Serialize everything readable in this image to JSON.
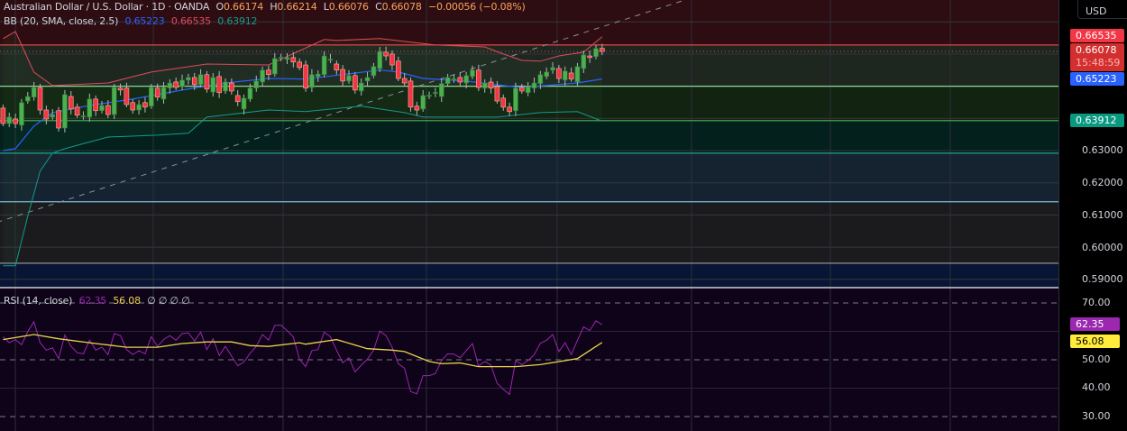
{
  "header": {
    "symbol": "Australian Dollar / U.S. Dollar · 1D · OANDA",
    "o_label": "O",
    "o_value": "0.66174",
    "h_label": "H",
    "h_value": "0.66214",
    "l_label": "L",
    "l_value": "0.66076",
    "c_label": "C",
    "c_value": "0.66078",
    "change": "−0.00056 (−0.08%)"
  },
  "bb_legend": {
    "label": "BB (20, SMA, close, 2.5)",
    "basis": "0.65223",
    "upper": "0.66535",
    "lower": "0.63912"
  },
  "rsi_legend": {
    "label": "RSI (14, close)",
    "rsi": "62.35",
    "ma": "56.08",
    "empty": "∅ ∅ ∅ ∅"
  },
  "currency_button": "USD",
  "price_axis": {
    "ticks": [
      "0.63000",
      "0.62000",
      "0.61000",
      "0.60000",
      "0.59000"
    ],
    "tags": {
      "bb_upper": "0.66535",
      "last_price": "0.66078",
      "countdown": "15:48:59",
      "bb_basis": "0.65223",
      "bb_lower": "0.63912"
    }
  },
  "rsi_axis": {
    "ticks": [
      "70.00",
      "50.00",
      "40.00",
      "30.00"
    ],
    "tags": {
      "rsi": "62.35",
      "ma": "56.08"
    }
  },
  "colors": {
    "up": "#4caf50",
    "down": "#f23645",
    "bb_upper": "#e04a5a",
    "bb_basis": "#2962ff",
    "bb_lower": "#159a8a",
    "rsi": "#9c27b0",
    "rsi_ma": "#e8d44d"
  },
  "chart_data": [
    {
      "type": "candlestick",
      "title": "Australian Dollar / U.S. Dollar · 1D · OANDA",
      "ylim": [
        0.585,
        0.672
      ],
      "horizontal_levels": [
        0.6628,
        0.65,
        0.6393,
        0.6292,
        0.6141,
        0.595
      ],
      "trendline": {
        "from_index": -1,
        "from_price": 0.6077,
        "slope_per_bar": 0.00062
      },
      "candles_oc": [
        [
          0.6432,
          0.6384
        ],
        [
          0.6384,
          0.6404
        ],
        [
          0.6398,
          0.6384
        ],
        [
          0.6379,
          0.6449
        ],
        [
          0.6454,
          0.6468
        ],
        [
          0.6466,
          0.6496
        ],
        [
          0.6496,
          0.6426
        ],
        [
          0.6426,
          0.6398
        ],
        [
          0.6404,
          0.6412
        ],
        [
          0.6424,
          0.637
        ],
        [
          0.637,
          0.6474
        ],
        [
          0.6468,
          0.6429
        ],
        [
          0.6435,
          0.641
        ],
        [
          0.6407,
          0.6408
        ],
        [
          0.6404,
          0.646
        ],
        [
          0.646,
          0.6424
        ],
        [
          0.6424,
          0.644
        ],
        [
          0.644,
          0.6412
        ],
        [
          0.6412,
          0.6496
        ],
        [
          0.6494,
          0.6488
        ],
        [
          0.6494,
          0.6443
        ],
        [
          0.6449,
          0.6426
        ],
        [
          0.6426,
          0.6443
        ],
        [
          0.6449,
          0.6435
        ],
        [
          0.6438,
          0.6496
        ],
        [
          0.6494,
          0.6466
        ],
        [
          0.646,
          0.6496
        ],
        [
          0.6494,
          0.651
        ],
        [
          0.6513,
          0.6496
        ],
        [
          0.6499,
          0.6519
        ],
        [
          0.6519,
          0.6527
        ],
        [
          0.6527,
          0.6505
        ],
        [
          0.6505,
          0.6536
        ],
        [
          0.6536,
          0.6491
        ],
        [
          0.6482,
          0.6527
        ],
        [
          0.653,
          0.648
        ],
        [
          0.6485,
          0.6513
        ],
        [
          0.651,
          0.6485
        ],
        [
          0.6471,
          0.6452
        ],
        [
          0.6429,
          0.6463
        ],
        [
          0.646,
          0.6494
        ],
        [
          0.6494,
          0.6516
        ],
        [
          0.6513,
          0.655
        ],
        [
          0.655,
          0.6536
        ],
        [
          0.6538,
          0.6586
        ],
        [
          0.6589,
          0.659
        ],
        [
          0.6583,
          0.6589
        ],
        [
          0.6589,
          0.6575
        ],
        [
          0.6575,
          0.6558
        ],
        [
          0.6566,
          0.6494
        ],
        [
          0.6496,
          0.6536
        ],
        [
          0.653,
          0.6538
        ],
        [
          0.6536,
          0.6594
        ],
        [
          0.6583,
          0.6584
        ],
        [
          0.6569,
          0.655
        ],
        [
          0.6552,
          0.6516
        ],
        [
          0.6516,
          0.6533
        ],
        [
          0.6533,
          0.6488
        ],
        [
          0.6485,
          0.651
        ],
        [
          0.6516,
          0.6527
        ],
        [
          0.6533,
          0.6561
        ],
        [
          0.6555,
          0.6608
        ],
        [
          0.6606,
          0.6594
        ],
        [
          0.66,
          0.6566
        ],
        [
          0.6578,
          0.6524
        ],
        [
          0.6524,
          0.651
        ],
        [
          0.6516,
          0.6435
        ],
        [
          0.6438,
          0.6426
        ],
        [
          0.6429,
          0.6471
        ],
        [
          0.6471,
          0.6472
        ],
        [
          0.648,
          0.6481
        ],
        [
          0.6468,
          0.6508
        ],
        [
          0.6508,
          0.6527
        ],
        [
          0.6522,
          0.6523
        ],
        [
          0.6527,
          0.6513
        ],
        [
          0.651,
          0.6533
        ],
        [
          0.653,
          0.655
        ],
        [
          0.655,
          0.6496
        ],
        [
          0.6494,
          0.651
        ],
        [
          0.6513,
          0.6494
        ],
        [
          0.6499,
          0.6454
        ],
        [
          0.6463,
          0.6435
        ],
        [
          0.6435,
          0.6421
        ],
        [
          0.6424,
          0.6494
        ],
        [
          0.6496,
          0.6485
        ],
        [
          0.648,
          0.6499
        ],
        [
          0.6494,
          0.651
        ],
        [
          0.6508,
          0.6536
        ],
        [
          0.653,
          0.6544
        ],
        [
          0.655,
          0.6558
        ],
        [
          0.6555,
          0.6524
        ],
        [
          0.6519,
          0.6547
        ],
        [
          0.6541,
          0.6522
        ],
        [
          0.6513,
          0.6561
        ],
        [
          0.6555,
          0.6597
        ],
        [
          0.6594,
          0.6589
        ],
        [
          0.6592,
          0.6617
        ],
        [
          0.66174,
          0.66078
        ]
      ],
      "bb_upper": [
        [
          0,
          0.6648
        ],
        [
          2,
          0.667
        ],
        [
          5,
          0.6544
        ],
        [
          8,
          0.6502
        ],
        [
          17,
          0.651
        ],
        [
          24,
          0.6544
        ],
        [
          33,
          0.6569
        ],
        [
          43,
          0.6566
        ],
        [
          52,
          0.6645
        ],
        [
          54,
          0.6642
        ],
        [
          61,
          0.6648
        ],
        [
          70,
          0.6628
        ],
        [
          78,
          0.6622
        ],
        [
          81,
          0.66
        ],
        [
          84,
          0.658
        ],
        [
          87,
          0.6578
        ],
        [
          90,
          0.6594
        ],
        [
          94,
          0.6606
        ],
        [
          97,
          0.66535
        ]
      ],
      "bb_basis": [
        [
          0,
          0.63
        ],
        [
          2,
          0.6306
        ],
        [
          5,
          0.6376
        ],
        [
          8,
          0.6418
        ],
        [
          14,
          0.644
        ],
        [
          21,
          0.646
        ],
        [
          29,
          0.6488
        ],
        [
          36,
          0.651
        ],
        [
          43,
          0.6524
        ],
        [
          49,
          0.6522
        ],
        [
          55,
          0.6536
        ],
        [
          61,
          0.655
        ],
        [
          64,
          0.6544
        ],
        [
          68,
          0.6524
        ],
        [
          75,
          0.6516
        ],
        [
          81,
          0.6502
        ],
        [
          84,
          0.6496
        ],
        [
          93,
          0.651
        ],
        [
          97,
          0.65223
        ]
      ],
      "bb_lower": [
        [
          0,
          0.5942
        ],
        [
          2,
          0.5942
        ],
        [
          4,
          0.6096
        ],
        [
          6,
          0.6236
        ],
        [
          8,
          0.6292
        ],
        [
          10,
          0.6306
        ],
        [
          17,
          0.6342
        ],
        [
          25,
          0.6348
        ],
        [
          30,
          0.6354
        ],
        [
          33,
          0.6404
        ],
        [
          43,
          0.6426
        ],
        [
          49,
          0.6421
        ],
        [
          58,
          0.6438
        ],
        [
          65,
          0.6418
        ],
        [
          68,
          0.6404
        ],
        [
          80,
          0.6404
        ],
        [
          87,
          0.6418
        ],
        [
          93,
          0.6421
        ],
        [
          97,
          0.63912
        ]
      ]
    },
    {
      "type": "line",
      "title": "RSI (14, close)",
      "ylim": [
        27,
        75
      ],
      "bands": [
        70,
        50,
        30
      ],
      "rsi": [
        58.1,
        56.0,
        57.1,
        55.3,
        59.9,
        63.4,
        56.0,
        53.4,
        54.2,
        50.4,
        58.7,
        54.7,
        52.5,
        52.1,
        56.9,
        53.4,
        54.4,
        51.8,
        59.2,
        58.5,
        53.6,
        51.8,
        53.2,
        52.1,
        58.1,
        54.7,
        57.1,
        58.5,
        56.9,
        59.2,
        59.5,
        56.6,
        59.7,
        53.6,
        57.4,
        51.5,
        54.7,
        51.3,
        47.9,
        49.2,
        52.3,
        54.7,
        58.9,
        56.9,
        62.1,
        62.2,
        60.3,
        58.1,
        50.2,
        47.6,
        53.2,
        53.6,
        59.7,
        58.1,
        53.4,
        48.9,
        50.7,
        45.7,
        48.1,
        50.2,
        53.4,
        60.1,
        58.5,
        54.4,
        48.6,
        47.0,
        38.8,
        38.0,
        44.4,
        44.4,
        45.1,
        49.7,
        52.1,
        52.0,
        50.7,
        53.2,
        55.7,
        47.8,
        49.4,
        48.1,
        41.7,
        39.6,
        37.8,
        49.7,
        48.3,
        49.7,
        51.8,
        55.8,
        56.9,
        58.9,
        52.9,
        56.0,
        51.8,
        56.8,
        61.6,
        60.3,
        63.7,
        62.35
      ],
      "rsi_ma": [
        [
          0,
          57.1
        ],
        [
          5,
          58.9
        ],
        [
          9,
          57.4
        ],
        [
          14,
          56.0
        ],
        [
          20,
          54.4
        ],
        [
          25,
          54.4
        ],
        [
          29,
          55.7
        ],
        [
          33,
          56.3
        ],
        [
          37,
          56.3
        ],
        [
          40,
          55.0
        ],
        [
          43,
          54.7
        ],
        [
          48,
          56.0
        ],
        [
          49,
          55.5
        ],
        [
          54,
          57.1
        ],
        [
          59,
          53.9
        ],
        [
          63,
          53.4
        ],
        [
          65,
          52.9
        ],
        [
          69,
          49.4
        ],
        [
          71,
          48.6
        ],
        [
          74,
          48.9
        ],
        [
          77,
          47.6
        ],
        [
          83,
          47.6
        ],
        [
          87,
          48.3
        ],
        [
          93,
          50.4
        ],
        [
          97,
          56.08
        ]
      ]
    }
  ]
}
